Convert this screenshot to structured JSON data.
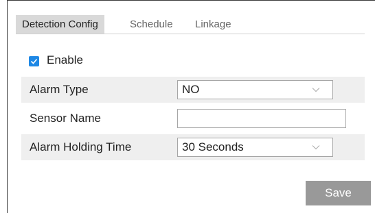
{
  "tabs": [
    {
      "label": "Detection Config",
      "active": true
    },
    {
      "label": "Schedule",
      "active": false
    },
    {
      "label": "Linkage",
      "active": false
    }
  ],
  "enable": {
    "label": "Enable",
    "checked": true
  },
  "form": {
    "alarm_type": {
      "label": "Alarm Type",
      "value": "NO"
    },
    "sensor_name": {
      "label": "Sensor Name",
      "value": ""
    },
    "alarm_holding_time": {
      "label": "Alarm Holding Time",
      "value": "30 Seconds"
    }
  },
  "save_label": "Save",
  "icons": {
    "checkbox": "checkmark-icon",
    "dropdown": "chevron-down-icon"
  },
  "colors": {
    "checkbox": "#1e88e5",
    "active_tab": "#d9d9d9",
    "row_shade": "#efefef",
    "save_button": "#999999"
  }
}
